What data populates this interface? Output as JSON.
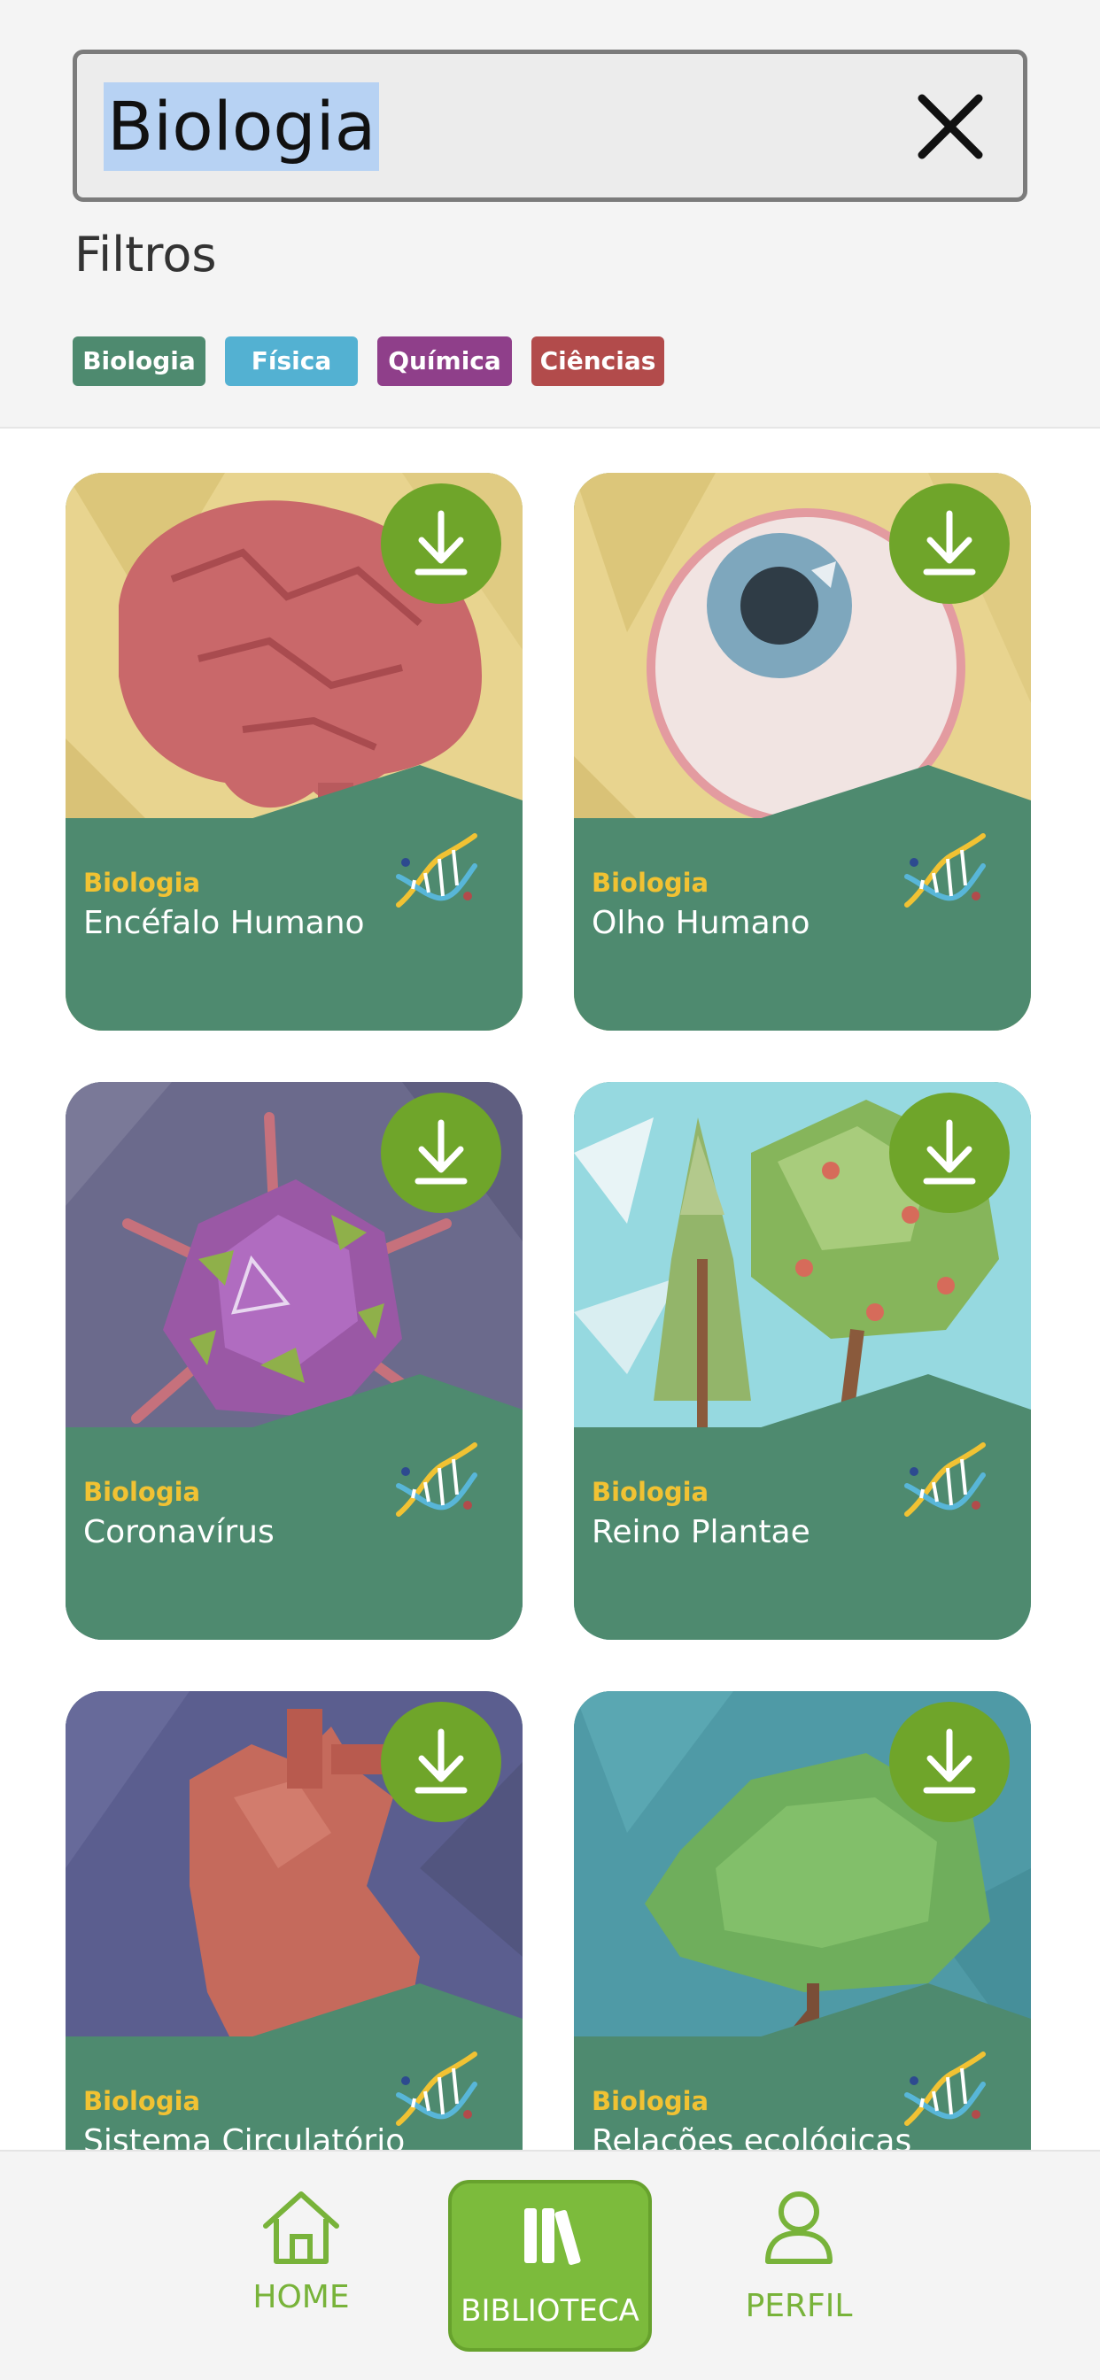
{
  "search": {
    "value": "Biologia"
  },
  "filters": {
    "label": "Filtros",
    "chips": [
      {
        "label": "Biologia",
        "color": "#4e8a6f"
      },
      {
        "label": "Física",
        "color": "#53b1d2"
      },
      {
        "label": "Química",
        "color": "#8f3f8a"
      },
      {
        "label": "Ciências",
        "color": "#b24b4b"
      }
    ]
  },
  "cards": [
    {
      "category": "Biologia",
      "title": "Encéfalo Humano",
      "art": "brain"
    },
    {
      "category": "Biologia",
      "title": "Olho Humano",
      "art": "eye"
    },
    {
      "category": "Biologia",
      "title": "Coronavírus",
      "art": "virus"
    },
    {
      "category": "Biologia",
      "title": "Reino Plantae",
      "art": "trees"
    },
    {
      "category": "Biologia",
      "title": "Sistema Circulatório",
      "art": "heart"
    },
    {
      "category": "Biologia",
      "title": "Relações ecológicas",
      "art": "eco-tree"
    }
  ],
  "nav": {
    "home": "HOME",
    "library": "BIBLIOTECA",
    "profile": "PERFIL",
    "active": "library"
  },
  "colors": {
    "accent": "#7cbb3c",
    "card_green": "#4e8a6f",
    "download_green": "#6fa52a",
    "category_yellow": "#f1c233"
  }
}
